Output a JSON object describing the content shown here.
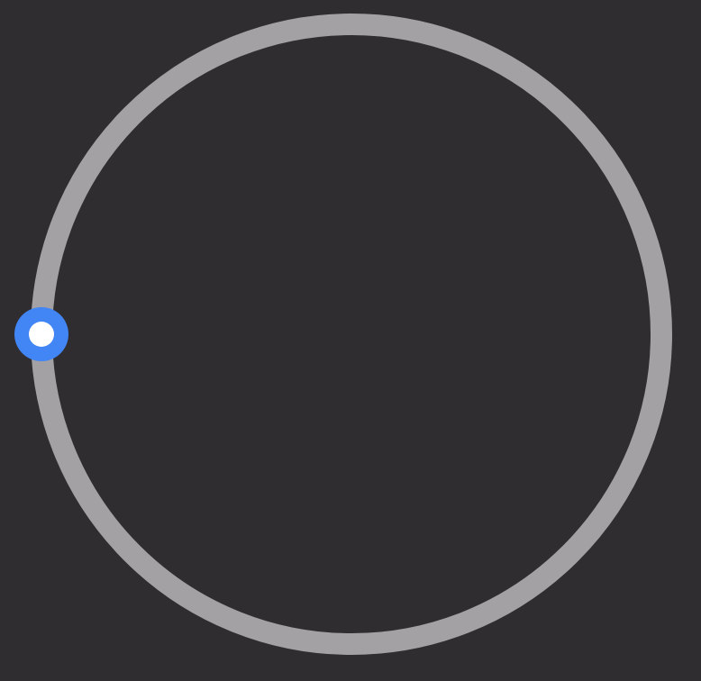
{
  "dial": {
    "value_degrees": 180,
    "colors": {
      "background": "#2f2d30",
      "track": "#a3a1a4",
      "thumb_ring": "#4285f4",
      "thumb_center": "#ffffff"
    }
  }
}
